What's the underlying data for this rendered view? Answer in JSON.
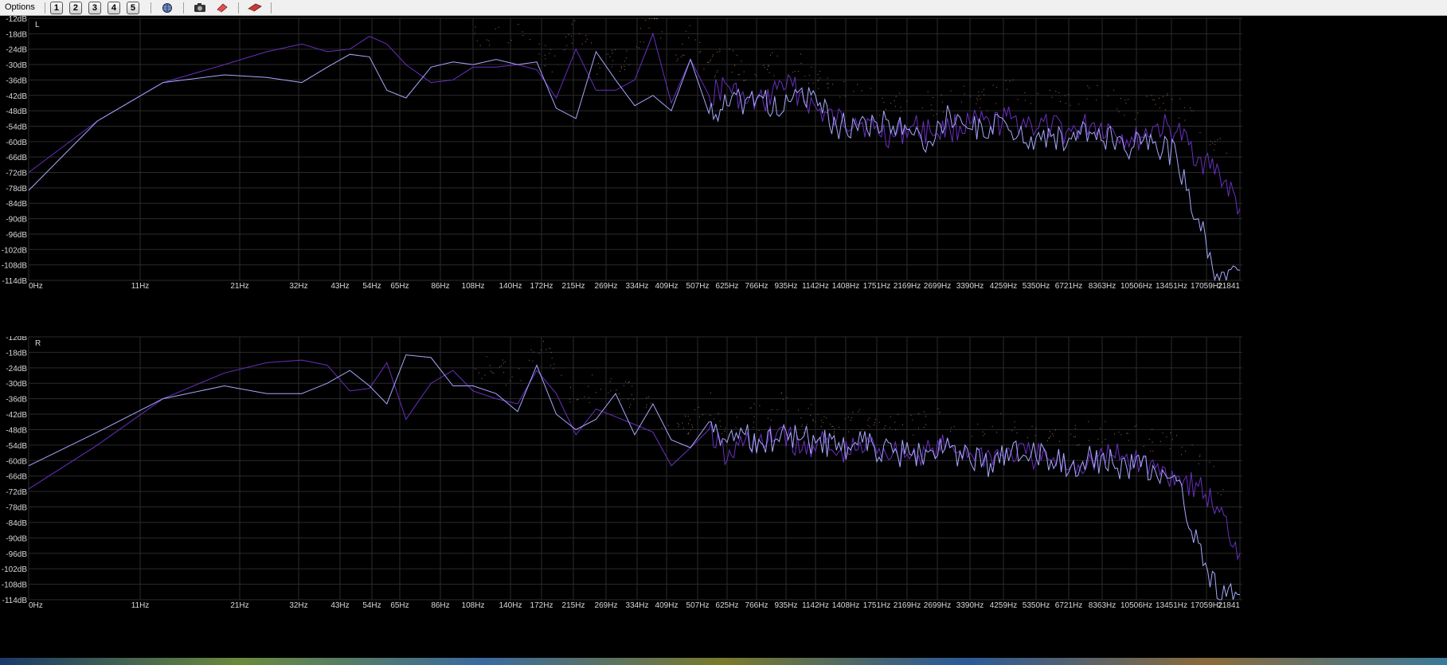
{
  "toolbar": {
    "menu_label": "Options",
    "numbers": [
      "1",
      "2",
      "3",
      "4",
      "5"
    ],
    "icons": [
      "globe-icon",
      "camera-icon",
      "eraser-icon",
      "book-icon"
    ]
  },
  "colors": {
    "background": "#000000",
    "grid": "#2b2b2b",
    "axis_text": "#d8d8d8",
    "series_a": "#6a2fc0",
    "series_b": "#a8a8ff",
    "peak_dots": "#a07050"
  },
  "chart_data": [
    {
      "type": "line",
      "channel_label": "L",
      "x_tick_labels": [
        "0Hz",
        "11Hz",
        "21Hz",
        "32Hz",
        "43Hz",
        "54Hz",
        "65Hz",
        "86Hz",
        "108Hz",
        "140Hz",
        "172Hz",
        "215Hz",
        "269Hz",
        "334Hz",
        "409Hz",
        "507Hz",
        "625Hz",
        "766Hz",
        "935Hz",
        "1142Hz",
        "1408Hz",
        "1751Hz",
        "2169Hz",
        "2699Hz",
        "3390Hz",
        "4259Hz",
        "5350Hz",
        "6721Hz",
        "8363Hz",
        "10506Hz",
        "13451Hz",
        "17059Hz",
        "21841"
      ],
      "y_tick_labels": [
        "-12dB",
        "-18dB",
        "-24dB",
        "-30dB",
        "-36dB",
        "-42dB",
        "-48dB",
        "-54dB",
        "-60dB",
        "-66dB",
        "-72dB",
        "-78dB",
        "-84dB",
        "-90dB",
        "-96dB",
        "-102dB",
        "-108dB",
        "-114dB"
      ],
      "ylim": [
        -114,
        -12
      ],
      "series": [
        {
          "values": [
            -72,
            -52,
            -37,
            -30,
            -25,
            -22,
            -25,
            -24,
            -19,
            -22,
            -30,
            -37,
            -36,
            -31,
            -31,
            -30,
            -32,
            -43,
            -24,
            -40,
            -40,
            -36,
            -18,
            -45,
            -28,
            -42,
            -38,
            -45,
            -45,
            -37,
            -41,
            -48,
            -52,
            -51,
            -55,
            -58,
            -54,
            -56,
            -55,
            -53,
            -54,
            -51,
            -53,
            -55,
            -56,
            -53,
            -55,
            -60,
            -54,
            -56,
            -66,
            -72,
            -86
          ]
        },
        {
          "values": [
            -79,
            -52,
            -37,
            -34,
            -35,
            -37,
            -31,
            -26,
            -27,
            -40,
            -43,
            -31,
            -29,
            -30,
            -28,
            -30,
            -29,
            -47,
            -51,
            -25,
            -36,
            -46,
            -42,
            -48,
            -28,
            -49,
            -46,
            -44,
            -43,
            -49,
            -40,
            -46,
            -54,
            -53,
            -52,
            -54,
            -57,
            -60,
            -49,
            -55,
            -54,
            -56,
            -58,
            -58,
            -59,
            -57,
            -60,
            -62,
            -60,
            -66,
            -90,
            -114,
            -110
          ]
        }
      ]
    },
    {
      "type": "line",
      "channel_label": "R",
      "x_tick_labels": [
        "0Hz",
        "11Hz",
        "21Hz",
        "32Hz",
        "43Hz",
        "54Hz",
        "65Hz",
        "86Hz",
        "108Hz",
        "140Hz",
        "172Hz",
        "215Hz",
        "269Hz",
        "334Hz",
        "409Hz",
        "507Hz",
        "625Hz",
        "766Hz",
        "935Hz",
        "1142Hz",
        "1408Hz",
        "1751Hz",
        "2169Hz",
        "2699Hz",
        "3390Hz",
        "4259Hz",
        "5350Hz",
        "6721Hz",
        "8363Hz",
        "10506Hz",
        "13451Hz",
        "17059Hz",
        "21841"
      ],
      "y_tick_labels": [
        "-12dB",
        "-18dB",
        "-24dB",
        "-30dB",
        "-36dB",
        "-42dB",
        "-48dB",
        "-54dB",
        "-60dB",
        "-66dB",
        "-72dB",
        "-78dB",
        "-84dB",
        "-90dB",
        "-96dB",
        "-102dB",
        "-108dB",
        "-114dB"
      ],
      "ylim": [
        -114,
        -12
      ],
      "series": [
        {
          "values": [
            -71,
            -54,
            -36,
            -26,
            -22,
            -21,
            -23,
            -33,
            -32,
            -22,
            -44,
            -30,
            -25,
            -33,
            -36,
            -38,
            -25,
            -34,
            -50,
            -40,
            -43,
            -46,
            -49,
            -62,
            -55,
            -48,
            -60,
            -52,
            -55,
            -47,
            -57,
            -52,
            -58,
            -56,
            -54,
            -57,
            -58,
            -56,
            -55,
            -57,
            -58,
            -57,
            -58,
            -60,
            -62,
            -60,
            -58,
            -60,
            -63,
            -66,
            -70,
            -80,
            -96
          ]
        },
        {
          "values": [
            -62,
            -49,
            -36,
            -31,
            -34,
            -34,
            -30,
            -25,
            -31,
            -38,
            -19,
            -20,
            -31,
            -31,
            -34,
            -41,
            -23,
            -42,
            -48,
            -44,
            -34,
            -50,
            -38,
            -52,
            -55,
            -45,
            -53,
            -50,
            -54,
            -49,
            -52,
            -52,
            -56,
            -53,
            -55,
            -57,
            -58,
            -56,
            -55,
            -60,
            -61,
            -57,
            -58,
            -60,
            -62,
            -59,
            -61,
            -63,
            -64,
            -68,
            -92,
            -114,
            -112
          ]
        }
      ]
    }
  ]
}
